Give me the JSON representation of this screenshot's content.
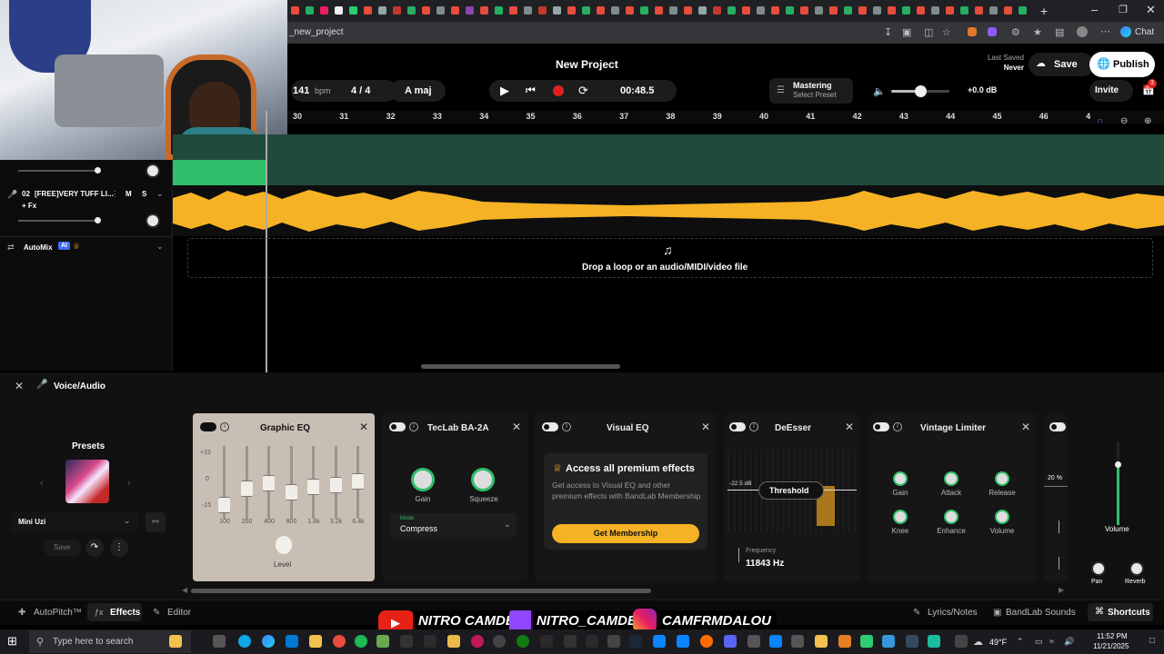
{
  "browser": {
    "tab_title": "_new_project",
    "window_controls": [
      "minimize-icon",
      "restore-icon",
      "close-icon"
    ],
    "chat_label": "Chat"
  },
  "header": {
    "project_title": "New Project",
    "bpm_value": "141",
    "bpm_unit": "bpm",
    "time_signature": "4 / 4",
    "key": "A maj",
    "time_display": "00:48.5",
    "mastering_label": "Mastering",
    "mastering_preset": "Select Preset",
    "volume_db": "+0.0 dB",
    "volume_level": 0.5,
    "last_saved_label": "Last Saved",
    "last_saved_value": "Never",
    "save_label": "Save",
    "publish_label": "Publish",
    "invite_label": "Invite",
    "badge_count": "3"
  },
  "ruler": {
    "bars": [
      "30",
      "31",
      "32",
      "33",
      "34",
      "35",
      "36",
      "37",
      "38",
      "39",
      "40",
      "41",
      "42",
      "43",
      "44",
      "45",
      "46",
      "4"
    ]
  },
  "tracks": [
    {
      "number": "02",
      "name": "[FREE]VERY TUFF LI...",
      "mute": "M",
      "solo": "S",
      "fx": "+ Fx"
    }
  ],
  "automix": {
    "label": "AutoMix",
    "badge": "AI"
  },
  "dropzone_text": "Drop a loop or an audio/MIDI/video file",
  "panel": {
    "title": "Voice/Audio",
    "presets_title": "Presets",
    "preset_name": "Mini Uzi",
    "save_label": "Save"
  },
  "effects": {
    "graphic_eq": {
      "title": "Graphic EQ",
      "scale": [
        "+15",
        "0",
        "-15"
      ],
      "bands": [
        "100",
        "200",
        "400",
        "800",
        "1.6k",
        "3.2k",
        "6.4k"
      ],
      "level_label": "Level"
    },
    "teclab": {
      "title": "TecLab BA-2A",
      "gain_label": "Gain",
      "squeeze_label": "Squeeze",
      "mode_label": "Mode",
      "mode_value": "Compress"
    },
    "visual_eq": {
      "title": "Visual EQ",
      "promo_title": "Access all premium effects",
      "promo_text": "Get access to Visual EQ and other premium effects with BandLab Membership",
      "cta": "Get Membership"
    },
    "deesser": {
      "title": "DeEsser",
      "threshold_label": "Threshold",
      "threshold_value": "-22.5 dB",
      "frequency_label": "Frequency",
      "frequency_value": "11843 Hz"
    },
    "vintage_limiter": {
      "title": "Vintage Limiter",
      "knobs": [
        "Gain",
        "Attack",
        "Release",
        "Knee",
        "Enhance",
        "Volume"
      ]
    },
    "partial": {
      "value": "20 %"
    }
  },
  "master_strip": {
    "volume_label": "Volume",
    "pan_label": "Pan",
    "reverb_label": "Reverb"
  },
  "footer": {
    "autopitch": "AutoPitch™",
    "effects": "Effects",
    "editor": "Editor",
    "lyrics": "Lyrics/Notes",
    "sounds": "BandLab Sounds",
    "shortcuts": "Shortcuts"
  },
  "overlays": {
    "youtube": "NITRO CAMDEN",
    "twitch": "NITRO_CAMDEN",
    "instagram": "CAMFRMDALOU"
  },
  "taskbar": {
    "search_placeholder": "Type here to search",
    "weather": "49°F",
    "time": "11:52 PM",
    "date": "11/21/2025"
  }
}
